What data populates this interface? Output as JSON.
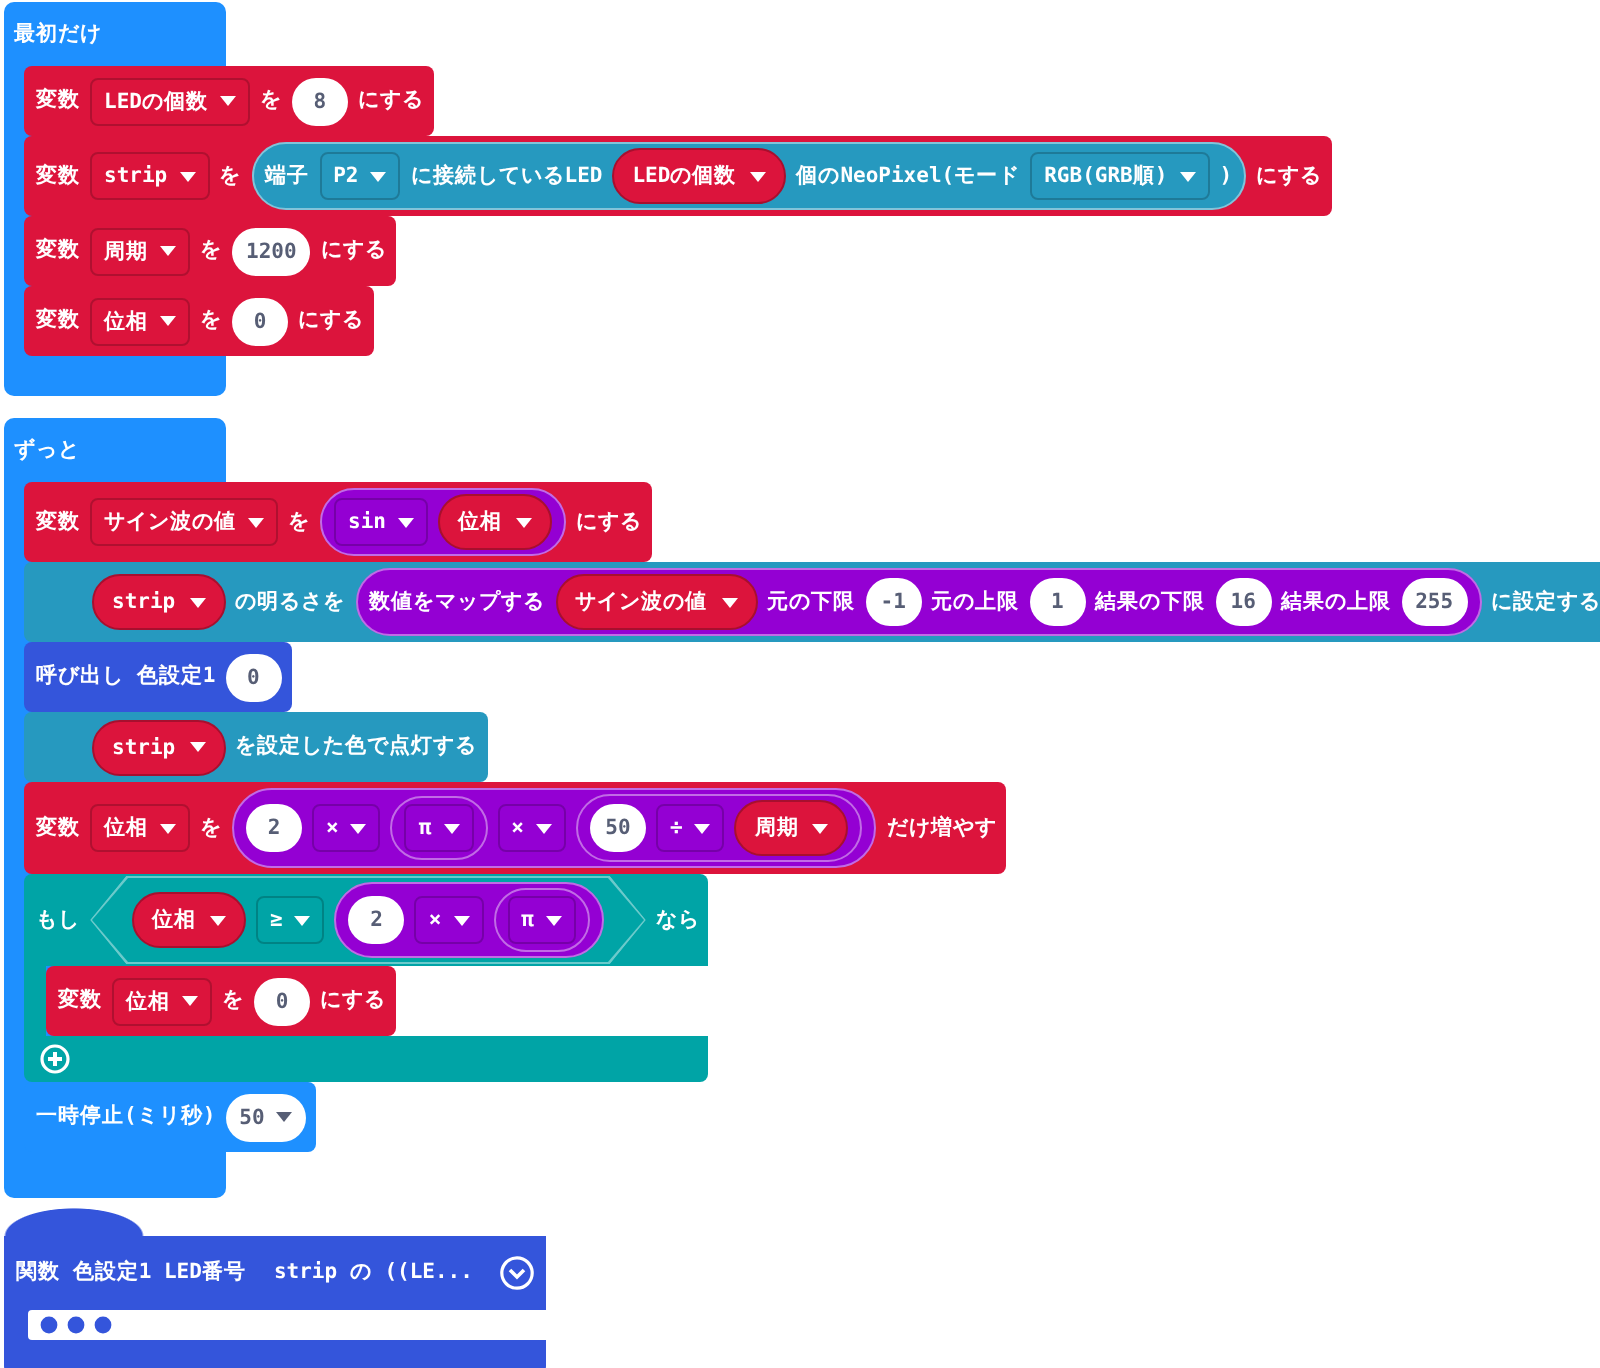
{
  "scripts": [
    {
      "kind": "hat",
      "color": "#1e90ff",
      "label": "最初だけ",
      "body": [
        {
          "kind": "statement",
          "color": "#dc143c",
          "parts": [
            {
              "kind": "label",
              "text": "変数"
            },
            {
              "kind": "dropdown",
              "text": "LEDの個数"
            },
            {
              "kind": "label",
              "text": "を"
            },
            {
              "kind": "number",
              "text": "8"
            },
            {
              "kind": "label",
              "text": "にする"
            }
          ]
        },
        {
          "kind": "statement",
          "color": "#dc143c",
          "parts": [
            {
              "kind": "label",
              "text": "変数"
            },
            {
              "kind": "dropdown",
              "text": "strip"
            },
            {
              "kind": "label",
              "text": "を"
            },
            {
              "kind": "reporter",
              "color": "#2699bf",
              "parts": [
                {
                  "kind": "label",
                  "text": "端子"
                },
                {
                  "kind": "dropdown",
                  "text": "P2"
                },
                {
                  "kind": "label",
                  "text": "に接続しているLED"
                },
                {
                  "kind": "variable",
                  "text": "LEDの個数"
                },
                {
                  "kind": "label",
                  "text": "個のNeoPixel(モード"
                },
                {
                  "kind": "dropdown",
                  "text": "RGB(GRB順)"
                },
                {
                  "kind": "label",
                  "text": ")"
                }
              ]
            },
            {
              "kind": "label",
              "text": "にする"
            }
          ]
        },
        {
          "kind": "statement",
          "color": "#dc143c",
          "parts": [
            {
              "kind": "label",
              "text": "変数"
            },
            {
              "kind": "dropdown",
              "text": "周期"
            },
            {
              "kind": "label",
              "text": "を"
            },
            {
              "kind": "number",
              "text": "1200"
            },
            {
              "kind": "label",
              "text": "にする"
            }
          ]
        },
        {
          "kind": "statement",
          "color": "#dc143c",
          "parts": [
            {
              "kind": "label",
              "text": "変数"
            },
            {
              "kind": "dropdown",
              "text": "位相"
            },
            {
              "kind": "label",
              "text": "を"
            },
            {
              "kind": "number",
              "text": "0"
            },
            {
              "kind": "label",
              "text": "にする"
            }
          ]
        }
      ]
    },
    {
      "kind": "hat",
      "color": "#1e90ff",
      "label": "ずっと",
      "body": [
        {
          "kind": "statement",
          "color": "#dc143c",
          "parts": [
            {
              "kind": "label",
              "text": "変数"
            },
            {
              "kind": "dropdown",
              "text": "サイン波の値"
            },
            {
              "kind": "label",
              "text": "を"
            },
            {
              "kind": "reporter",
              "color": "#9400d3",
              "parts": [
                {
                  "kind": "dropdown",
                  "text": "sin"
                },
                {
                  "kind": "variable",
                  "text": "位相"
                }
              ]
            },
            {
              "kind": "label",
              "text": "にする"
            }
          ]
        },
        {
          "kind": "statement",
          "color": "#2699bf",
          "parts": [
            {
              "kind": "variable",
              "text": "strip"
            },
            {
              "kind": "label",
              "text": "の明るさを"
            },
            {
              "kind": "reporter",
              "color": "#9400d3",
              "parts": [
                {
                  "kind": "label",
                  "text": "数値をマップする"
                },
                {
                  "kind": "variable",
                  "text": "サイン波の値"
                },
                {
                  "kind": "label",
                  "text": "元の下限"
                },
                {
                  "kind": "number",
                  "text": "-1"
                },
                {
                  "kind": "label",
                  "text": "元の上限"
                },
                {
                  "kind": "number",
                  "text": "1"
                },
                {
                  "kind": "label",
                  "text": "結果の下限"
                },
                {
                  "kind": "number",
                  "text": "16"
                },
                {
                  "kind": "label",
                  "text": "結果の上限"
                },
                {
                  "kind": "number",
                  "text": "255"
                }
              ]
            },
            {
              "kind": "label",
              "text": "に設定する"
            }
          ]
        },
        {
          "kind": "statement",
          "color": "#3455db",
          "parts": [
            {
              "kind": "label",
              "text": "呼び出し 色設定1"
            },
            {
              "kind": "number",
              "text": "0"
            }
          ]
        },
        {
          "kind": "statement",
          "color": "#2699bf",
          "parts": [
            {
              "kind": "variable",
              "text": "strip"
            },
            {
              "kind": "label",
              "text": "を設定した色で点灯する"
            }
          ]
        },
        {
          "kind": "statement",
          "color": "#dc143c",
          "parts": [
            {
              "kind": "label",
              "text": "変数"
            },
            {
              "kind": "dropdown",
              "text": "位相"
            },
            {
              "kind": "label",
              "text": "を"
            },
            {
              "kind": "reporter",
              "color": "#9400d3",
              "parts": [
                {
                  "kind": "number",
                  "text": "2"
                },
                {
                  "kind": "dropdown",
                  "text": "×"
                },
                {
                  "kind": "reporter",
                  "color": "#9400d3",
                  "parts": [
                    {
                      "kind": "dropdown",
                      "text": "π"
                    }
                  ]
                },
                {
                  "kind": "dropdown",
                  "text": "×"
                },
                {
                  "kind": "reporter",
                  "color": "#9400d3",
                  "parts": [
                    {
                      "kind": "number",
                      "text": "50"
                    },
                    {
                      "kind": "dropdown",
                      "text": "÷"
                    },
                    {
                      "kind": "variable",
                      "text": "周期"
                    }
                  ]
                }
              ]
            },
            {
              "kind": "label",
              "text": "だけ増やす"
            }
          ]
        },
        {
          "kind": "if",
          "color": "#00a4a6",
          "parts": [
            {
              "kind": "label",
              "text": "もし"
            },
            {
              "kind": "condition",
              "color": "#00a4a6",
              "parts": [
                {
                  "kind": "variable",
                  "text": "位相"
                },
                {
                  "kind": "dropdown",
                  "text": "≥"
                },
                {
                  "kind": "reporter",
                  "color": "#9400d3",
                  "parts": [
                    {
                      "kind": "number",
                      "text": "2"
                    },
                    {
                      "kind": "dropdown",
                      "text": "×"
                    },
                    {
                      "kind": "reporter",
                      "color": "#9400d3",
                      "parts": [
                        {
                          "kind": "dropdown",
                          "text": "π"
                        }
                      ]
                    }
                  ]
                }
              ]
            },
            {
              "kind": "label",
              "text": "なら"
            }
          ],
          "body": [
            {
              "kind": "statement",
              "color": "#dc143c",
              "parts": [
                {
                  "kind": "label",
                  "text": "変数"
                },
                {
                  "kind": "dropdown",
                  "text": "位相"
                },
                {
                  "kind": "label",
                  "text": "を"
                },
                {
                  "kind": "number",
                  "text": "0"
                },
                {
                  "kind": "label",
                  "text": "にする"
                }
              ]
            }
          ]
        },
        {
          "kind": "statement",
          "color": "#1e90ff",
          "parts": [
            {
              "kind": "label",
              "text": "一時停止(ミリ秒)"
            },
            {
              "kind": "number_menu",
              "text": "50"
            }
          ]
        }
      ]
    },
    {
      "kind": "function",
      "color": "#3455db",
      "parts": [
        {
          "kind": "label",
          "text": "関数 色設定1 LED番号"
        },
        {
          "kind": "label",
          "text": "strip の ((LE..."
        }
      ],
      "collapsed": true
    }
  ]
}
